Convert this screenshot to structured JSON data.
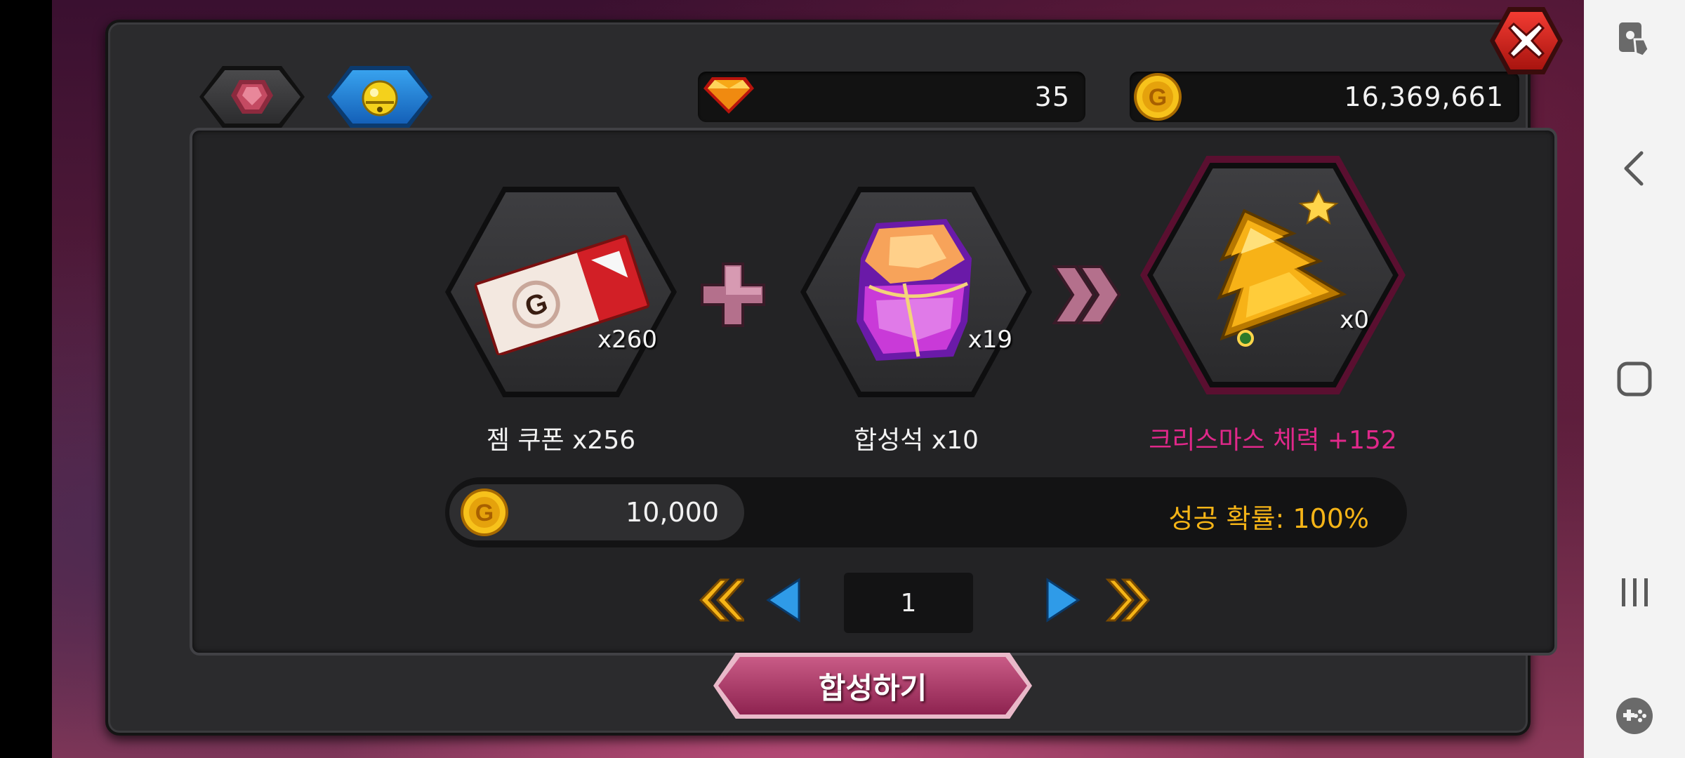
{
  "currency": {
    "diamonds": "35",
    "gold": "16,369,661"
  },
  "tabs": [
    {
      "name": "gem",
      "active": false
    },
    {
      "name": "bell",
      "active": true
    }
  ],
  "recipe": {
    "ingredient1": {
      "count": "x260",
      "label": "젬 쿠폰 x256",
      "icon": "gem-coupon-icon"
    },
    "ingredient2": {
      "count": "x19",
      "label": "합성석 x10",
      "icon": "synthesis-stone-icon"
    },
    "result": {
      "count": "x0",
      "label": "크리스마스 체력 +152",
      "icon": "christmas-tree-gem-icon",
      "label_color": "#e0288a"
    }
  },
  "cost": {
    "gold": "10,000",
    "success_rate": "성공 확률: 100%"
  },
  "pagination": {
    "current_page": "1"
  },
  "actions": {
    "combine_label": "합성하기"
  },
  "colors": {
    "accent_gold": "#f5b417",
    "nav_blue": "#2f9be8",
    "result_label": "#e0288a"
  }
}
